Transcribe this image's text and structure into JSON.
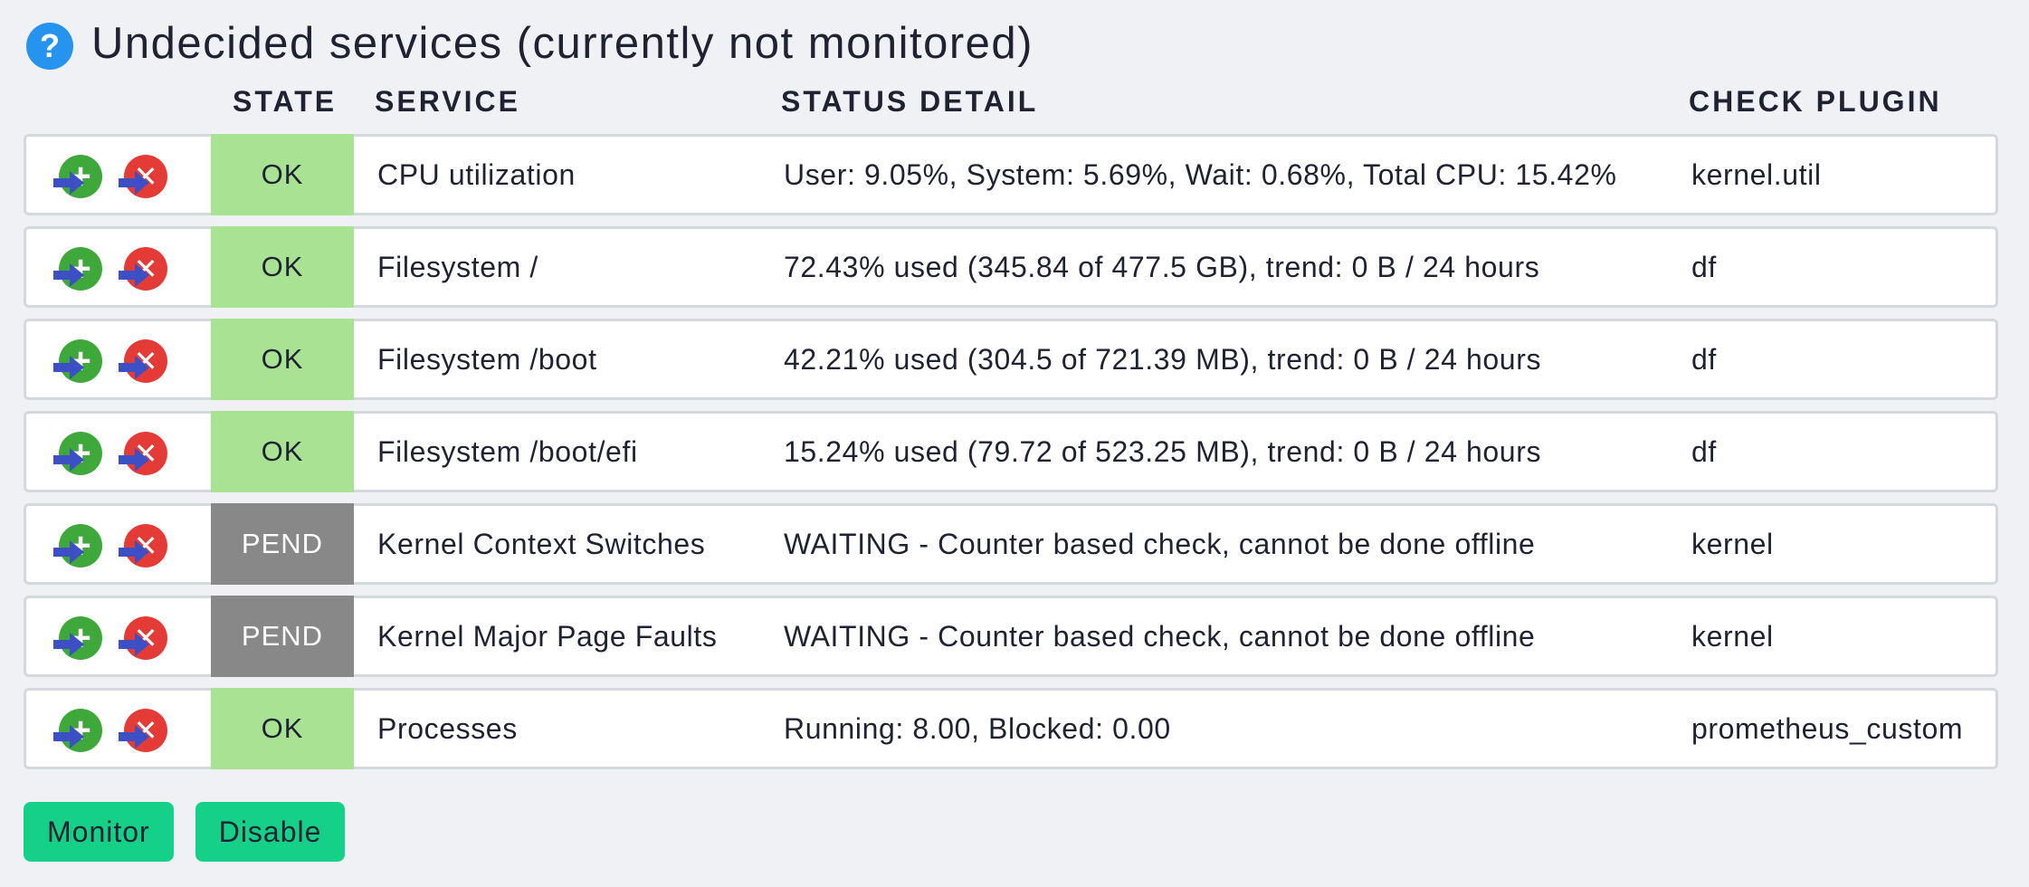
{
  "title": "Undecided services (currently not monitored)",
  "columns": {
    "state": "STATE",
    "service": "SERVICE",
    "status_detail": "STATUS DETAIL",
    "check_plugin": "CHECK PLUGIN"
  },
  "icons": {
    "help": "help-icon",
    "monitor": "monitor-icon",
    "disable": "disable-icon"
  },
  "colors": {
    "ok": "#a8e393",
    "pend": "#888888",
    "button": "#15d188",
    "monitor_icon": "#3fa83a",
    "disable_icon": "#e43b36"
  },
  "rows": [
    {
      "state": "OK",
      "service": "CPU utilization",
      "detail": "User: 9.05%, System: 5.69%, Wait: 0.68%, Total CPU: 15.42%",
      "plugin": "kernel.util"
    },
    {
      "state": "OK",
      "service": "Filesystem /",
      "detail": "72.43% used (345.84 of 477.5 GB), trend: 0 B / 24 hours",
      "plugin": "df"
    },
    {
      "state": "OK",
      "service": "Filesystem /boot",
      "detail": "42.21% used (304.5 of 721.39 MB), trend: 0 B / 24 hours",
      "plugin": "df"
    },
    {
      "state": "OK",
      "service": "Filesystem /boot/efi",
      "detail": "15.24% used (79.72 of 523.25 MB), trend: 0 B / 24 hours",
      "plugin": "df"
    },
    {
      "state": "PEND",
      "service": "Kernel Context Switches",
      "detail": "WAITING - Counter based check, cannot be done offline",
      "plugin": "kernel"
    },
    {
      "state": "PEND",
      "service": "Kernel Major Page Faults",
      "detail": "WAITING - Counter based check, cannot be done offline",
      "plugin": "kernel"
    },
    {
      "state": "OK",
      "service": "Processes",
      "detail": "Running: 8.00, Blocked: 0.00",
      "plugin": "prometheus_custom"
    }
  ],
  "actions": {
    "monitor_label": "Monitor",
    "disable_label": "Disable"
  }
}
